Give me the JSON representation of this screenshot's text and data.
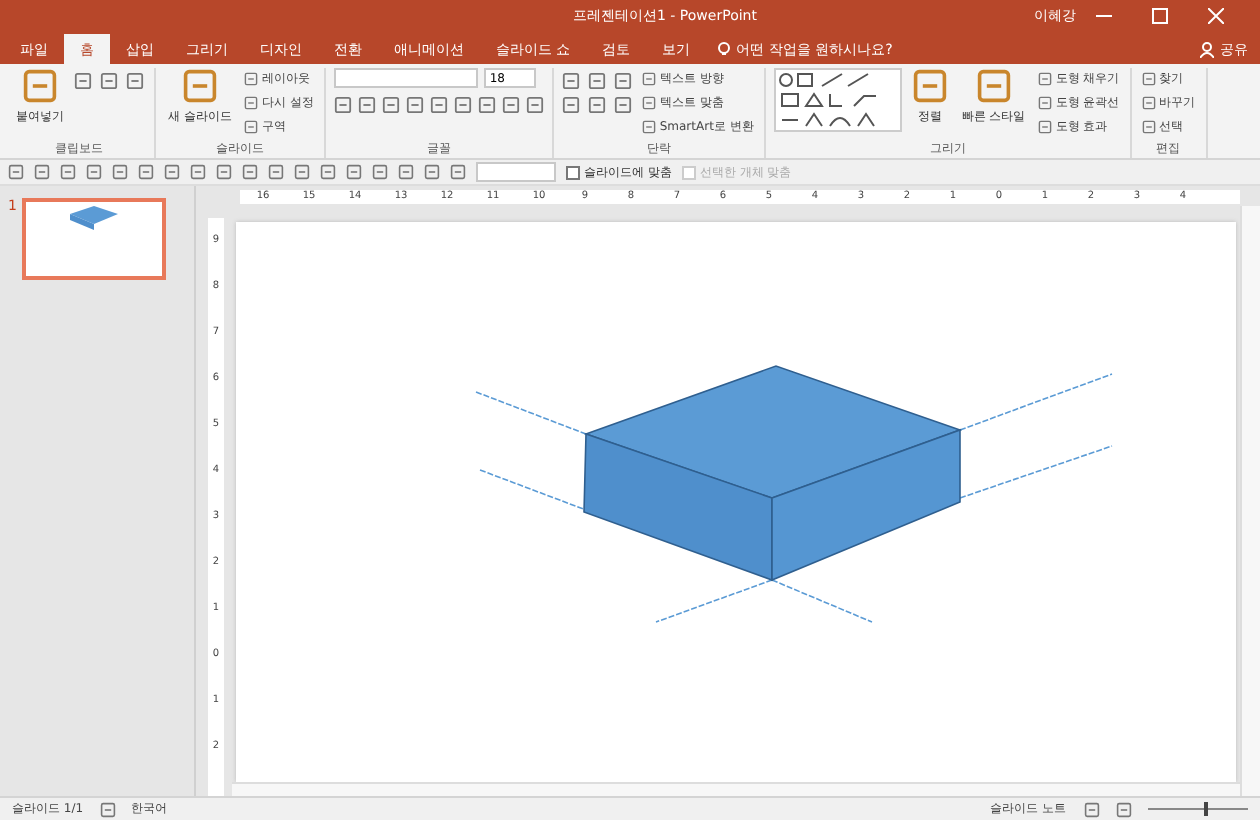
{
  "window": {
    "title": "프레젠테이션1 - PowerPoint",
    "user": "이혜강"
  },
  "tabs": [
    {
      "label": "파일",
      "selected": false
    },
    {
      "label": "홈",
      "selected": true
    },
    {
      "label": "삽입",
      "selected": false
    },
    {
      "label": "그리기",
      "selected": false
    },
    {
      "label": "디자인",
      "selected": false
    },
    {
      "label": "전환",
      "selected": false
    },
    {
      "label": "애니메이션",
      "selected": false
    },
    {
      "label": "슬라이드 쇼",
      "selected": false
    },
    {
      "label": "검토",
      "selected": false
    },
    {
      "label": "보기",
      "selected": false
    }
  ],
  "tell_me": {
    "placeholder": "어떤 작업을 원하시나요?"
  },
  "share": "공유",
  "ribbon": [
    {
      "label": "클립보드",
      "items": [
        {
          "kind": "large",
          "label": "붙여넣기"
        },
        {
          "kind": "clipboard_tools"
        }
      ]
    },
    {
      "label": "슬라이드",
      "items": [
        {
          "kind": "large",
          "label": "새 슬라이드"
        },
        {
          "kind": "stack",
          "entries": [
            "레이아웃",
            "다시 설정",
            "구역"
          ]
        }
      ]
    },
    {
      "label": "글꼴",
      "items": [
        {
          "kind": "font"
        }
      ]
    },
    {
      "label": "단락",
      "items": [
        {
          "kind": "paragraph_tools"
        },
        {
          "kind": "stack",
          "entries": [
            "텍스트 방향",
            "텍스트 맞춤",
            "SmartArt로 변환"
          ]
        }
      ]
    },
    {
      "label": "그리기",
      "items": [
        {
          "kind": "gallery"
        },
        {
          "kind": "large",
          "label": "정렬"
        },
        {
          "kind": "large",
          "label": "빠른 스타일"
        },
        {
          "kind": "stack",
          "entries": [
            "도형 채우기",
            "도형 윤곽선",
            "도형 효과"
          ]
        }
      ]
    },
    {
      "label": "편집",
      "items": [
        {
          "kind": "stack",
          "entries": [
            "찾기",
            "바꾸기",
            "선택"
          ]
        }
      ]
    }
  ],
  "font": {
    "size": "18"
  },
  "toolbar": {
    "checkboxes": [
      {
        "label": "슬라이드에 맞춤",
        "checked": false,
        "disabled": false
      },
      {
        "label": "선택한 개체 맞춤",
        "checked": false,
        "disabled": true
      }
    ]
  },
  "thumbnails": [
    {
      "number": "1",
      "selected": true
    }
  ],
  "ruler": {
    "horizontal": [
      "16",
      "15",
      "14",
      "13",
      "12",
      "11",
      "10",
      "9",
      "8",
      "7",
      "6",
      "5",
      "4",
      "3",
      "2",
      "1",
      "0",
      "1",
      "2",
      "3",
      "4"
    ],
    "vertical": [
      "9",
      "8",
      "7",
      "6",
      "5",
      "4",
      "3",
      "2",
      "1",
      "0",
      "1",
      "2"
    ]
  },
  "status_bar": {
    "slide": "슬라이드 1/1",
    "language": "한국어",
    "notes": "슬라이드 노트",
    "zoom": {
      "level": 0.55
    }
  }
}
